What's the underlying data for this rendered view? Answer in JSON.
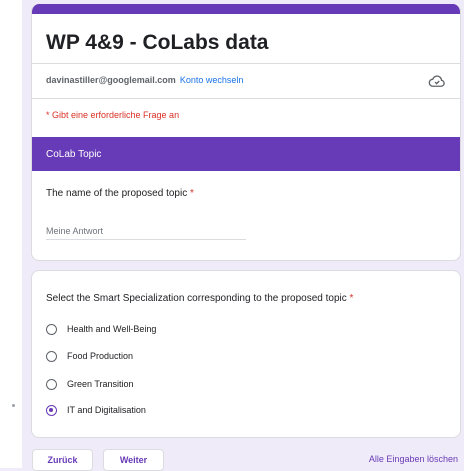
{
  "form": {
    "title": "WP 4&9 - CoLabs data",
    "accent_color": "#673ab7"
  },
  "account": {
    "email": "davinastiller@googlemail.com",
    "switch_label": "Konto wechseln",
    "icon": "cloud-icon"
  },
  "required_note": "* Gibt eine erforderliche Frage an",
  "section": {
    "title": "CoLab Topic"
  },
  "question1": {
    "title": "The name of the proposed topic",
    "required_mark": "*",
    "value": "",
    "placeholder": "Meine Antwort"
  },
  "question2": {
    "title": "Select the Smart Specialization corresponding to the proposed topic",
    "required_mark": "*",
    "options": [
      {
        "label": "Health and Well-Being",
        "selected": false
      },
      {
        "label": "Food Production",
        "selected": false
      },
      {
        "label": "Green Transition",
        "selected": false
      },
      {
        "label": "IT and Digitalisation",
        "selected": true
      }
    ]
  },
  "footer": {
    "back_label": "Zurück",
    "next_label": "Weiter",
    "clear_label": "Alle Eingaben löschen"
  }
}
